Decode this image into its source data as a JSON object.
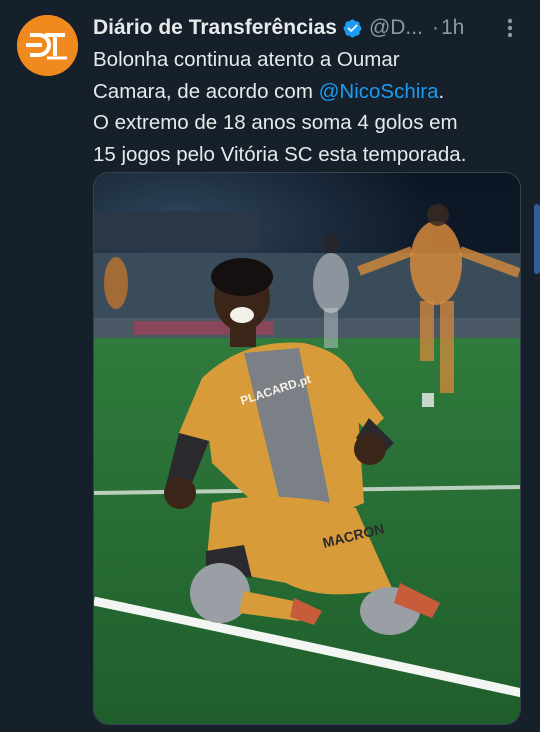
{
  "author": {
    "display_name": "Diário de Transferências",
    "handle": "@D...",
    "separator": "·",
    "time": "1h",
    "avatar_logo": "DT"
  },
  "tweet": {
    "text_line1": "Bolonha continua atento a Oumar",
    "text_line2_a": "Camara, de acordo com ",
    "mention": "@NicoSchira",
    "text_line2_b": ".",
    "text_line3": "O extremo de 18 anos soma 4 golos em",
    "text_line4": "15 jogos pelo Vitória SC esta temporada."
  },
  "media": {
    "jersey_sponsor": "PLACARD.pt",
    "shorts_brand": "MACRON"
  },
  "icons": {
    "verified": "verified-badge-icon",
    "more": "more-options-icon"
  },
  "colors": {
    "background": "#15202b",
    "text": "#e7e9ea",
    "muted": "#8b98a5",
    "accent": "#1d9bf0",
    "avatar": "#f08a1e"
  }
}
